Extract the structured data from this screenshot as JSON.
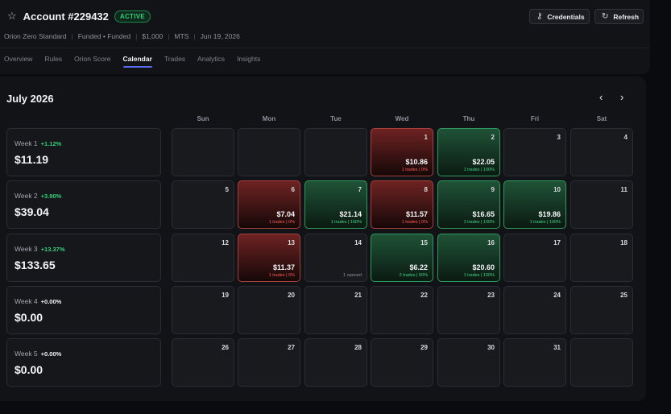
{
  "header": {
    "star_icon": "star-icon",
    "account_title": "Account #229432",
    "status_badge": "ACTIVE",
    "meta": [
      "Orion Zero Standard",
      "Funded • Funded",
      "$1,000",
      "MTS",
      "Jun 19, 2026"
    ],
    "credentials_label": "Credentials",
    "refresh_label": "Refresh"
  },
  "tabs": [
    {
      "label": "Overview"
    },
    {
      "label": "Rules"
    },
    {
      "label": "Orion Score"
    },
    {
      "label": "Calendar",
      "active": true
    },
    {
      "label": "Trades"
    },
    {
      "label": "Analytics"
    },
    {
      "label": "Insights"
    }
  ],
  "calendar": {
    "month": "July 2026",
    "weekdays": [
      "Sun",
      "Mon",
      "Tue",
      "Wed",
      "Thu",
      "Fri",
      "Sat"
    ],
    "weeks": [
      {
        "label": "Week 1",
        "pct": "+1.12%",
        "value": "$11.19"
      },
      {
        "label": "Week 2",
        "pct": "+3.90%",
        "value": "$39.04"
      },
      {
        "label": "Week 3",
        "pct": "+13.37%",
        "value": "$133.65"
      },
      {
        "label": "Week 4",
        "pct": "+0.00%",
        "value": "$0.00"
      },
      {
        "label": "Week 5",
        "pct": "+0.00%",
        "value": "$0.00"
      }
    ],
    "days": [
      {
        "n": "",
        "row": 0,
        "col": 0
      },
      {
        "n": "",
        "row": 0,
        "col": 1
      },
      {
        "n": "",
        "row": 0,
        "col": 2
      },
      {
        "n": "1",
        "row": 0,
        "col": 3,
        "type": "loss",
        "pnl": "$10.86",
        "stat": "1 trades | 0%"
      },
      {
        "n": "2",
        "row": 0,
        "col": 4,
        "type": "win",
        "pnl": "$22.05",
        "stat": "1 trades | 100%"
      },
      {
        "n": "3",
        "row": 0,
        "col": 5
      },
      {
        "n": "4",
        "row": 0,
        "col": 6
      },
      {
        "n": "5",
        "row": 1,
        "col": 0
      },
      {
        "n": "6",
        "row": 1,
        "col": 1,
        "type": "loss",
        "pnl": "$7.04",
        "stat": "1 trades | 0%"
      },
      {
        "n": "7",
        "row": 1,
        "col": 2,
        "type": "win",
        "pnl": "$21.14",
        "stat": "1 trades | 100%"
      },
      {
        "n": "8",
        "row": 1,
        "col": 3,
        "type": "loss",
        "pnl": "$11.57",
        "stat": "1 trades | 0%"
      },
      {
        "n": "9",
        "row": 1,
        "col": 4,
        "type": "win",
        "pnl": "$16.65",
        "stat": "1 trades | 100%"
      },
      {
        "n": "10",
        "row": 1,
        "col": 5,
        "type": "win",
        "pnl": "$19.86",
        "stat": "1 trades | 100%"
      },
      {
        "n": "11",
        "row": 1,
        "col": 6
      },
      {
        "n": "12",
        "row": 2,
        "col": 0
      },
      {
        "n": "13",
        "row": 2,
        "col": 1,
        "type": "loss",
        "pnl": "$11.37",
        "stat": "1 trades | 0%"
      },
      {
        "n": "14",
        "row": 2,
        "col": 2,
        "type": "neutral",
        "stat": "1 opened"
      },
      {
        "n": "15",
        "row": 2,
        "col": 3,
        "type": "win",
        "pnl": "$6.22",
        "stat": "2 trades | 50%"
      },
      {
        "n": "16",
        "row": 2,
        "col": 4,
        "type": "win",
        "pnl": "$20.60",
        "stat": "1 trades | 100%"
      },
      {
        "n": "17",
        "row": 2,
        "col": 5
      },
      {
        "n": "18",
        "row": 2,
        "col": 6
      },
      {
        "n": "19",
        "row": 3,
        "col": 0
      },
      {
        "n": "20",
        "row": 3,
        "col": 1
      },
      {
        "n": "21",
        "row": 3,
        "col": 2
      },
      {
        "n": "22",
        "row": 3,
        "col": 3
      },
      {
        "n": "23",
        "row": 3,
        "col": 4
      },
      {
        "n": "24",
        "row": 3,
        "col": 5
      },
      {
        "n": "25",
        "row": 3,
        "col": 6
      },
      {
        "n": "26",
        "row": 4,
        "col": 0
      },
      {
        "n": "27",
        "row": 4,
        "col": 1
      },
      {
        "n": "28",
        "row": 4,
        "col": 2
      },
      {
        "n": "29",
        "row": 4,
        "col": 3
      },
      {
        "n": "30",
        "row": 4,
        "col": 4
      },
      {
        "n": "31",
        "row": 4,
        "col": 5
      },
      {
        "n": "",
        "row": 4,
        "col": 6
      }
    ]
  },
  "colors": {
    "positive": "#33d17a",
    "negative": "#ff5a5a",
    "accent": "#5b6cf0",
    "neutral_pct": "#f2f3f5"
  }
}
